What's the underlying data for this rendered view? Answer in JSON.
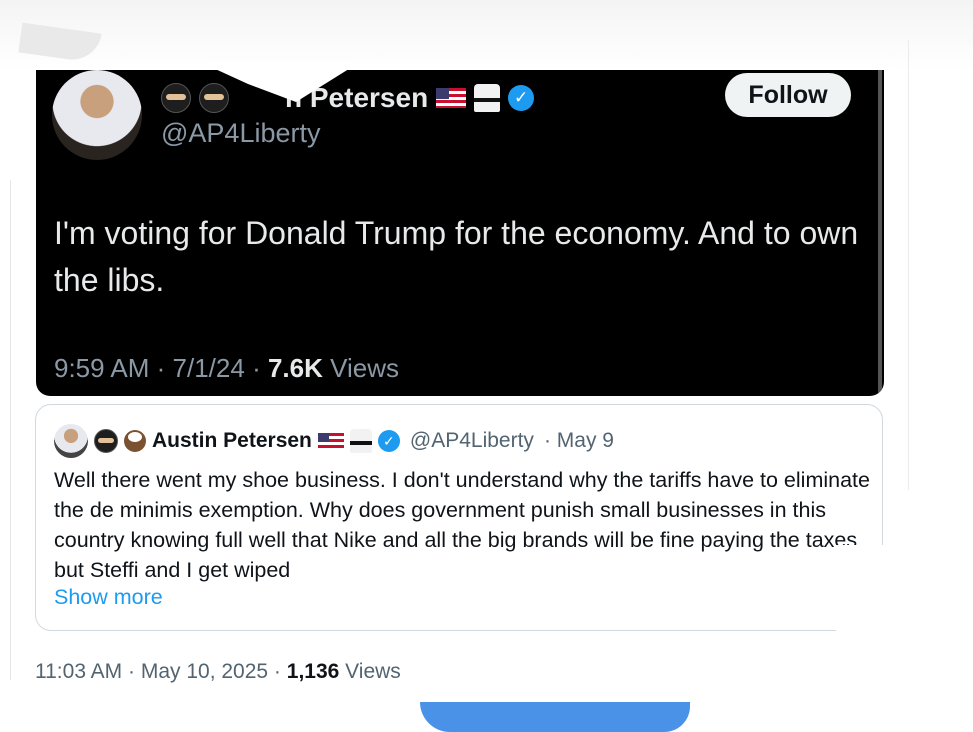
{
  "embedded_tweet": {
    "name": "Austin Petersen",
    "name_visible": "n Petersen",
    "handle": "@AP4Liberty",
    "follow_label": "Follow",
    "text": "I'm voting for Donald Trump for the economy. And to own the libs.",
    "time": "9:59 AM",
    "date": "7/1/24",
    "views_count": "7.6K",
    "views_label": "Views"
  },
  "quoted_tweet": {
    "name": "Austin Petersen",
    "handle": "@AP4Liberty",
    "date": "· May 9",
    "text": "Well there went my shoe business. I don't understand why the tariffs have to eliminate the de minimis exemption. Why does government punish small businesses in this country knowing full well that Nike and all the big brands will be fine paying the taxes but Steffi and I get wiped",
    "show_more": "Show more"
  },
  "tweet_meta": {
    "time_date": "11:03 AM · May 10, 2025 ·",
    "views_count": "1,136",
    "views_label": "Views"
  },
  "icons": [
    "ninja-icon",
    "sword-icon",
    "us-flag-icon",
    "karate-gi-icon",
    "verified-badge-icon",
    "eagle-icon"
  ],
  "colors": {
    "verified": "#1d9bf0",
    "link": "#1d9bf0",
    "muted": "#536471",
    "dark_bg": "#000000"
  }
}
